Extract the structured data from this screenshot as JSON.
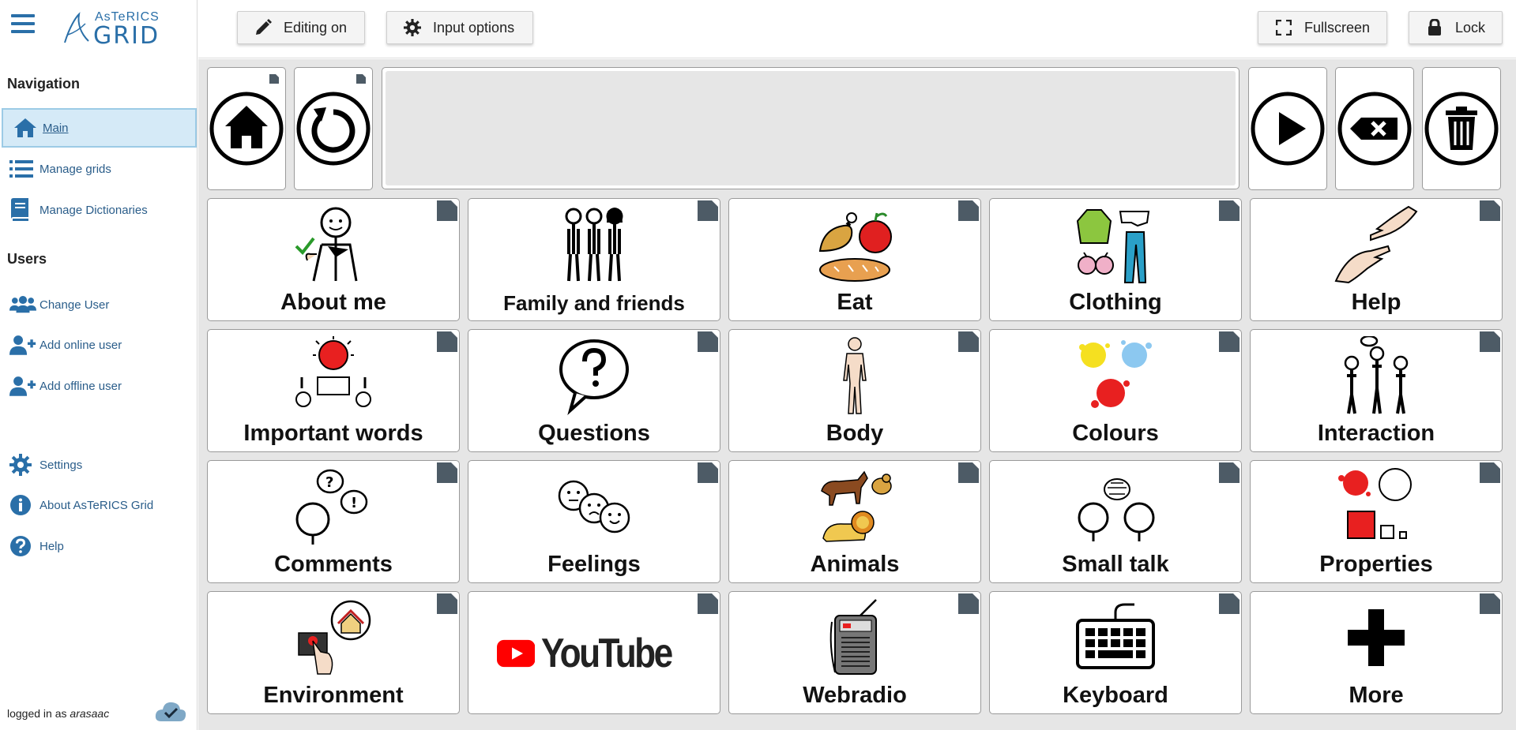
{
  "app": {
    "logo_top": "AsTeRICS",
    "logo_bottom": "GRID"
  },
  "sidebar": {
    "navigation_title": "Navigation",
    "navigation": [
      {
        "label": "Main",
        "icon": "home-icon",
        "active": true
      },
      {
        "label": "Manage grids",
        "icon": "list-icon"
      },
      {
        "label": "Manage Dictionaries",
        "icon": "book-icon"
      }
    ],
    "users_title": "Users",
    "users": [
      {
        "label": "Change User",
        "icon": "users-icon"
      },
      {
        "label": "Add online user",
        "icon": "user-plus-icon"
      },
      {
        "label": "Add offline user",
        "icon": "user-plus-icon"
      }
    ],
    "misc": [
      {
        "label": "Settings",
        "icon": "gear-icon"
      },
      {
        "label": "About AsTeRICS Grid",
        "icon": "info-icon"
      },
      {
        "label": "Help",
        "icon": "question-icon"
      }
    ],
    "logged_prefix": "logged in as",
    "logged_user": "arasaac"
  },
  "toolbar": {
    "editing": "Editing on",
    "input_options": "Input options",
    "fullscreen": "Fullscreen",
    "lock": "Lock"
  },
  "colors": {
    "accent": "#2a6fa8",
    "corner": "#4d5b66",
    "grid_bg": "#e6e6e6"
  },
  "grid": {
    "top_row": [
      "home-icon",
      "undo-icon",
      "message-bar",
      "play-icon",
      "backspace-icon",
      "trash-icon"
    ],
    "cells": [
      {
        "label": "About me",
        "icon": "person-pointing-self-icon"
      },
      {
        "label": "Family and friends",
        "icon": "family-icon"
      },
      {
        "label": "Eat",
        "icon": "food-icon"
      },
      {
        "label": "Clothing",
        "icon": "clothes-icon"
      },
      {
        "label": "Help",
        "icon": "helping-hands-icon"
      },
      {
        "label": "Important words",
        "icon": "important-words-icon"
      },
      {
        "label": "Questions",
        "icon": "question-bubble-icon"
      },
      {
        "label": "Body",
        "icon": "body-icon"
      },
      {
        "label": "Colours",
        "icon": "color-splash-icon"
      },
      {
        "label": "Interaction",
        "icon": "people-talking-icon"
      },
      {
        "label": "Comments",
        "icon": "comments-icon"
      },
      {
        "label": "Feelings",
        "icon": "faces-icon"
      },
      {
        "label": "Animals",
        "icon": "animals-icon"
      },
      {
        "label": "Small talk",
        "icon": "small-talk-icon"
      },
      {
        "label": "Properties",
        "icon": "shapes-icon"
      },
      {
        "label": "Environment",
        "icon": "environment-icon"
      },
      {
        "label": "",
        "icon": "youtube-logo",
        "logo_text": "YouTube"
      },
      {
        "label": "Webradio",
        "icon": "radio-icon"
      },
      {
        "label": "Keyboard",
        "icon": "keyboard-icon"
      },
      {
        "label": "More",
        "icon": "plus-icon"
      }
    ]
  }
}
